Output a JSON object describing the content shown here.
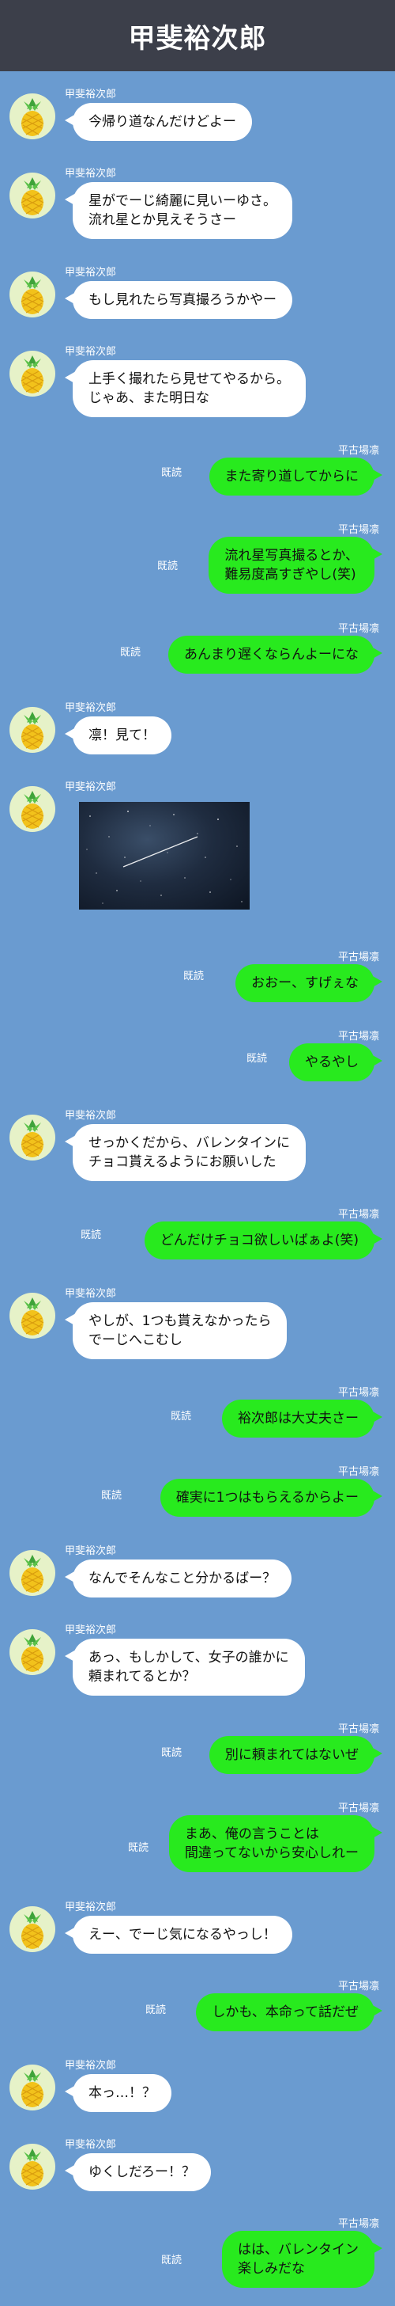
{
  "header": {
    "title": "甲斐裕次郎"
  },
  "names": {
    "incoming": "甲斐裕次郎",
    "outgoing": "平古場凛"
  },
  "read_label": "既読",
  "colors": {
    "background": "#6a9bd0",
    "header": "#3c3f4a",
    "outgoing_bubble": "#28ea1e",
    "incoming_bubble": "#ffffff"
  },
  "messages": [
    {
      "dir": "in",
      "text": "今帰り道なんだけどよー"
    },
    {
      "dir": "in",
      "text": "星がでーじ綺麗に見いーゆさ。\n流れ星とか見えそうさー"
    },
    {
      "dir": "in",
      "text": "もし見れたら写真撮ろうかやー"
    },
    {
      "dir": "in",
      "text": "上手く撮れたら見せてやるから。\nじゃあ、また明日な"
    },
    {
      "dir": "out",
      "text": "また寄り道してからに"
    },
    {
      "dir": "out",
      "text": "流れ星写真撮るとか、\n難易度高すぎやし(笑)"
    },
    {
      "dir": "out",
      "text": "あんまり遅くならんよーにな"
    },
    {
      "dir": "in",
      "text": "凛！見て！"
    },
    {
      "dir": "in",
      "photo": true,
      "text": ""
    },
    {
      "dir": "out",
      "text": "おおー、すげぇな"
    },
    {
      "dir": "out",
      "text": "やるやし"
    },
    {
      "dir": "in",
      "text": "せっかくだから、バレンタインに\nチョコ貰えるようにお願いした"
    },
    {
      "dir": "out",
      "text": "どんだけチョコ欲しいばぁよ(笑)"
    },
    {
      "dir": "in",
      "text": "やしが、1つも貰えなかったら\nでーじへこむし"
    },
    {
      "dir": "out",
      "text": "裕次郎は大丈夫さー"
    },
    {
      "dir": "out",
      "text": "確実に1つはもらえるからよー"
    },
    {
      "dir": "in",
      "text": "なんでそんなこと分かるばー？"
    },
    {
      "dir": "in",
      "text": "あっ、もしかして、女子の誰かに\n頼まれてるとか？"
    },
    {
      "dir": "out",
      "text": "別に頼まれてはないぜ"
    },
    {
      "dir": "out",
      "text": "まあ、俺の言うことは\n間違ってないから安心しれー"
    },
    {
      "dir": "in",
      "text": "えー、でーじ気になるやっし！"
    },
    {
      "dir": "out",
      "text": "しかも、本命って話だぜ"
    },
    {
      "dir": "in",
      "text": "本っ…！？"
    },
    {
      "dir": "in",
      "text": "ゆくしだろー！？"
    },
    {
      "dir": "out",
      "text": "はは、バレンタイン\n楽しみだな"
    }
  ]
}
